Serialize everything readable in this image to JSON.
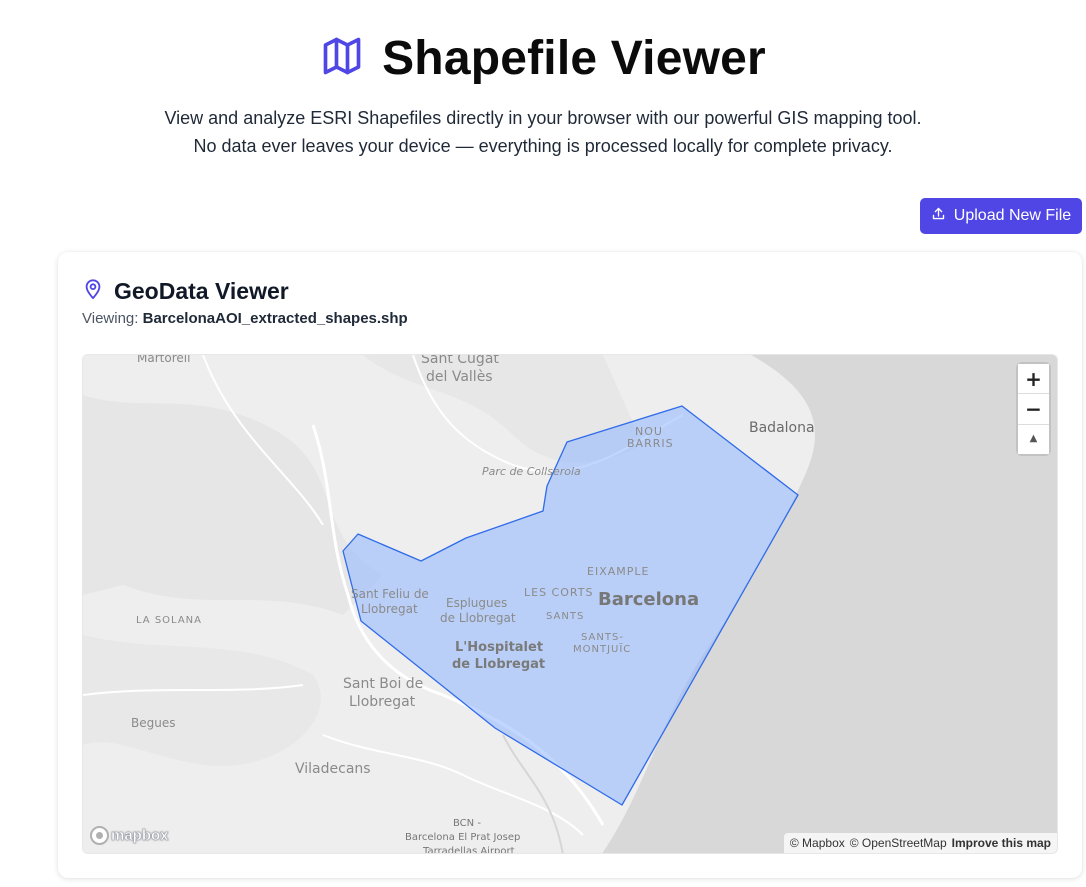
{
  "header": {
    "title": "Shapefile Viewer",
    "icon": "map-icon",
    "subtitle_line1": "View and analyze ESRI Shapefiles directly in your browser with our powerful GIS mapping tool.",
    "subtitle_line2": "No data ever leaves your device — everything is processed locally for complete privacy."
  },
  "actions": {
    "upload_label": "Upload New File",
    "upload_icon": "upload-icon"
  },
  "viewer": {
    "title": "GeoData Viewer",
    "icon": "map-pin-icon",
    "viewing_label": "Viewing:",
    "filename": "BarcelonaAOI_extracted_shapes.shp"
  },
  "map": {
    "places": {
      "martorell": "Martorell",
      "sant_cugat": "Sant Cugat",
      "del_valles": "del Vallès",
      "badalona": "Badalona",
      "nou": "NOU",
      "barris": "BARRIS",
      "parc": "Parc de Collserola",
      "eixample": "EIXAMPLE",
      "les_corts": "LES CORTS",
      "barcelona": "Barcelona",
      "sants": "SANTS",
      "sants_montjuic_1": "SANTS-",
      "sants_montjuic_2": "MONTJUÏC",
      "sant_feliu_1": "Sant Feliu de",
      "sant_feliu_2": "Llobregat",
      "esplugues_1": "Esplugues",
      "esplugues_2": "de Llobregat",
      "hospitalet_1": "L'Hospitalet",
      "hospitalet_2": "de Llobregat",
      "la_solana": "LA SOLANA",
      "sant_boi_1": "Sant Boi de",
      "sant_boi_2": "Llobregat",
      "begues": "Begues",
      "viladecans": "Viladecans",
      "bcn_1": "BCN -",
      "bcn_2": "Barcelona El Prat Josep",
      "bcn_3": "Tarradellas Airport"
    },
    "zoom_in": "+",
    "zoom_out": "−",
    "compass": "▲",
    "logo_text": "mapbox",
    "attribution_mapbox": "© Mapbox",
    "attribution_osm": "© OpenStreetMap",
    "improve": "Improve this map",
    "colors": {
      "polygon_fill": "#8fb7ff",
      "polygon_stroke": "#2f6bea",
      "sea": "#d8d8d8",
      "land": "#eeeeee"
    }
  },
  "theme": {
    "accent": "#4f46e5"
  }
}
